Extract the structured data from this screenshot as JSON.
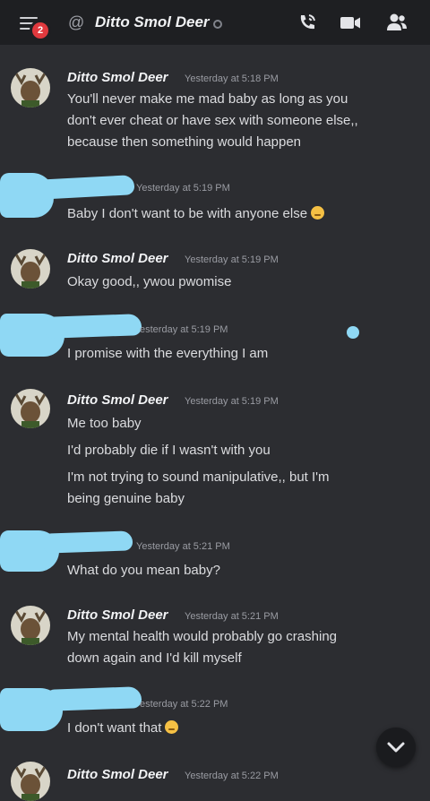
{
  "header": {
    "badge_count": "2",
    "at_symbol": "@",
    "channel_name": "Ditto Smol Deer",
    "icons": [
      "menu-icon",
      "at-icon",
      "status-icon",
      "call-icon",
      "video-icon",
      "members-icon"
    ]
  },
  "messages": [
    {
      "author": "Ditto Smol Deer",
      "timestamp": "Yesterday at 5:18 PM",
      "lines": [
        "You'll never make me mad baby as long as you",
        "don't ever cheat or have sex with someone else,,",
        "because then something would happen"
      ]
    },
    {
      "author": "",
      "timestamp": "Yesterday at 5:19 PM",
      "lines": [
        "Baby I don't want to be with anyone else"
      ]
    },
    {
      "author": "Ditto Smol Deer",
      "timestamp": "Yesterday at 5:19 PM",
      "lines": [
        "Okay good,, ywou pwomise"
      ]
    },
    {
      "author": "",
      "timestamp": "esterday at 5:19 PM",
      "lines": [
        "I promise with the everything I am"
      ]
    },
    {
      "author": "Ditto Smol Deer",
      "timestamp": "Yesterday at 5:19 PM",
      "lines": [
        "Me too baby",
        "I'd probably die if I wasn't with you",
        "I'm not trying to sound manipulative,, but I'm",
        "being genuine baby"
      ]
    },
    {
      "author": "",
      "timestamp": "Yesterday at 5:21 PM",
      "lines": [
        "What do you mean baby?"
      ]
    },
    {
      "author": "Ditto Smol Deer",
      "timestamp": "Yesterday at 5:21 PM",
      "lines": [
        "My mental health would probably go crashing",
        "down again and I'd kill myself"
      ]
    },
    {
      "author": "",
      "timestamp": "esterday at 5:22 PM",
      "lines": [
        "I don't want that"
      ]
    },
    {
      "author": "Ditto Smol Deer",
      "timestamp": "Yesterday at 5:22 PM",
      "lines": []
    }
  ],
  "emojis": [
    "pleading-face-emoji",
    "persevering-face-emoji"
  ],
  "scroll_button_icon": "chevron-down-icon",
  "colors": {
    "background": "#2c2d31",
    "topbar": "#1e1f22",
    "badge": "#e0393e",
    "redaction": "#8fd8f4"
  }
}
